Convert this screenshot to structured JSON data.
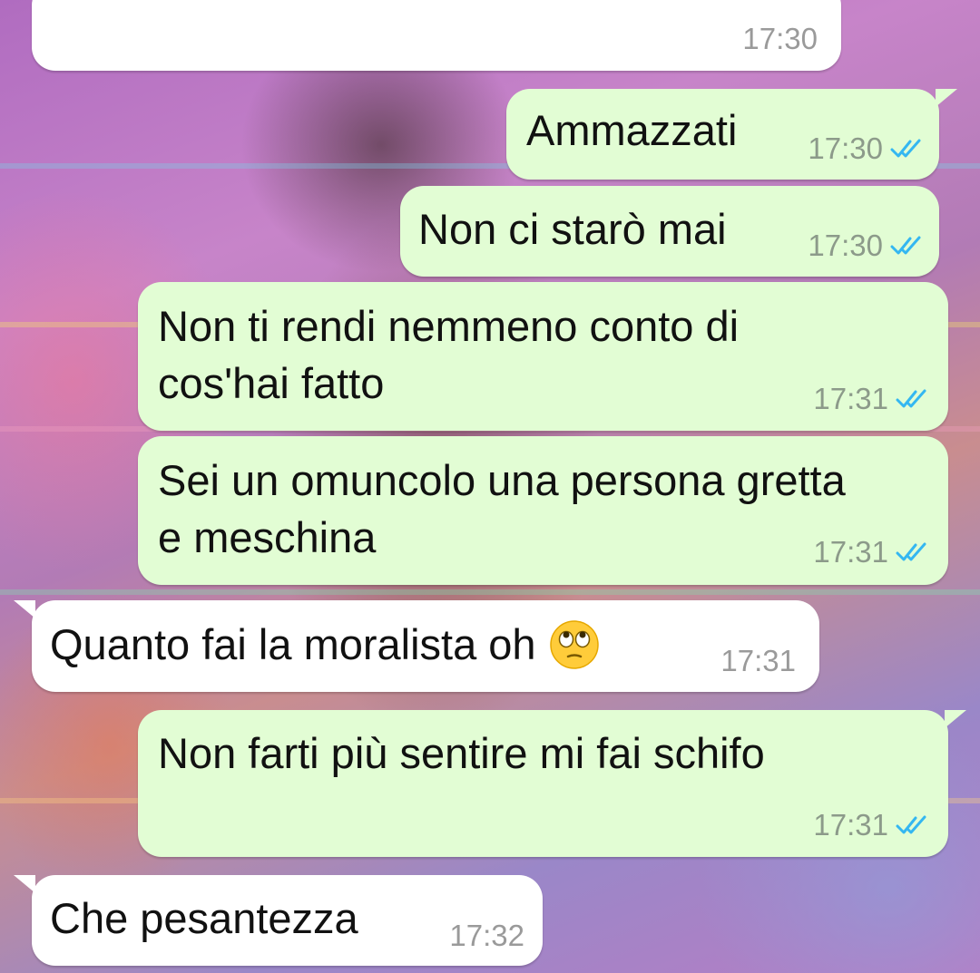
{
  "messages": [
    {
      "direction": "in",
      "text": "",
      "time": "17:30"
    },
    {
      "direction": "out",
      "text": "Ammazzati",
      "time": "17:30",
      "status": "read",
      "status_icon": "double-check-icon"
    },
    {
      "direction": "out",
      "text": "Non ci starò mai",
      "time": "17:30",
      "status": "read",
      "status_icon": "double-check-icon"
    },
    {
      "direction": "out",
      "lines": [
        "Non ti rendi nemmeno conto di",
        "cos'hai fatto"
      ],
      "time": "17:31",
      "status": "read",
      "status_icon": "double-check-icon"
    },
    {
      "direction": "out",
      "lines": [
        "Sei un omuncolo una persona gretta",
        "e meschina"
      ],
      "time": "17:31",
      "status": "read",
      "status_icon": "double-check-icon"
    },
    {
      "direction": "in",
      "text": "Quanto fai la moralista oh",
      "emoji": "face-with-rolling-eyes-emoji",
      "time": "17:31"
    },
    {
      "direction": "out",
      "text": "Non farti più sentire mi fai schifo",
      "time": "17:31",
      "status": "read",
      "status_icon": "double-check-icon"
    },
    {
      "direction": "in",
      "text": "Che pesantezza",
      "time": "17:32"
    }
  ],
  "colors": {
    "incoming_bubble": "#ffffff",
    "outgoing_bubble": "#e2fdd4",
    "read_ticks": "#34b7f1",
    "timestamp": "#8c9a8a"
  }
}
